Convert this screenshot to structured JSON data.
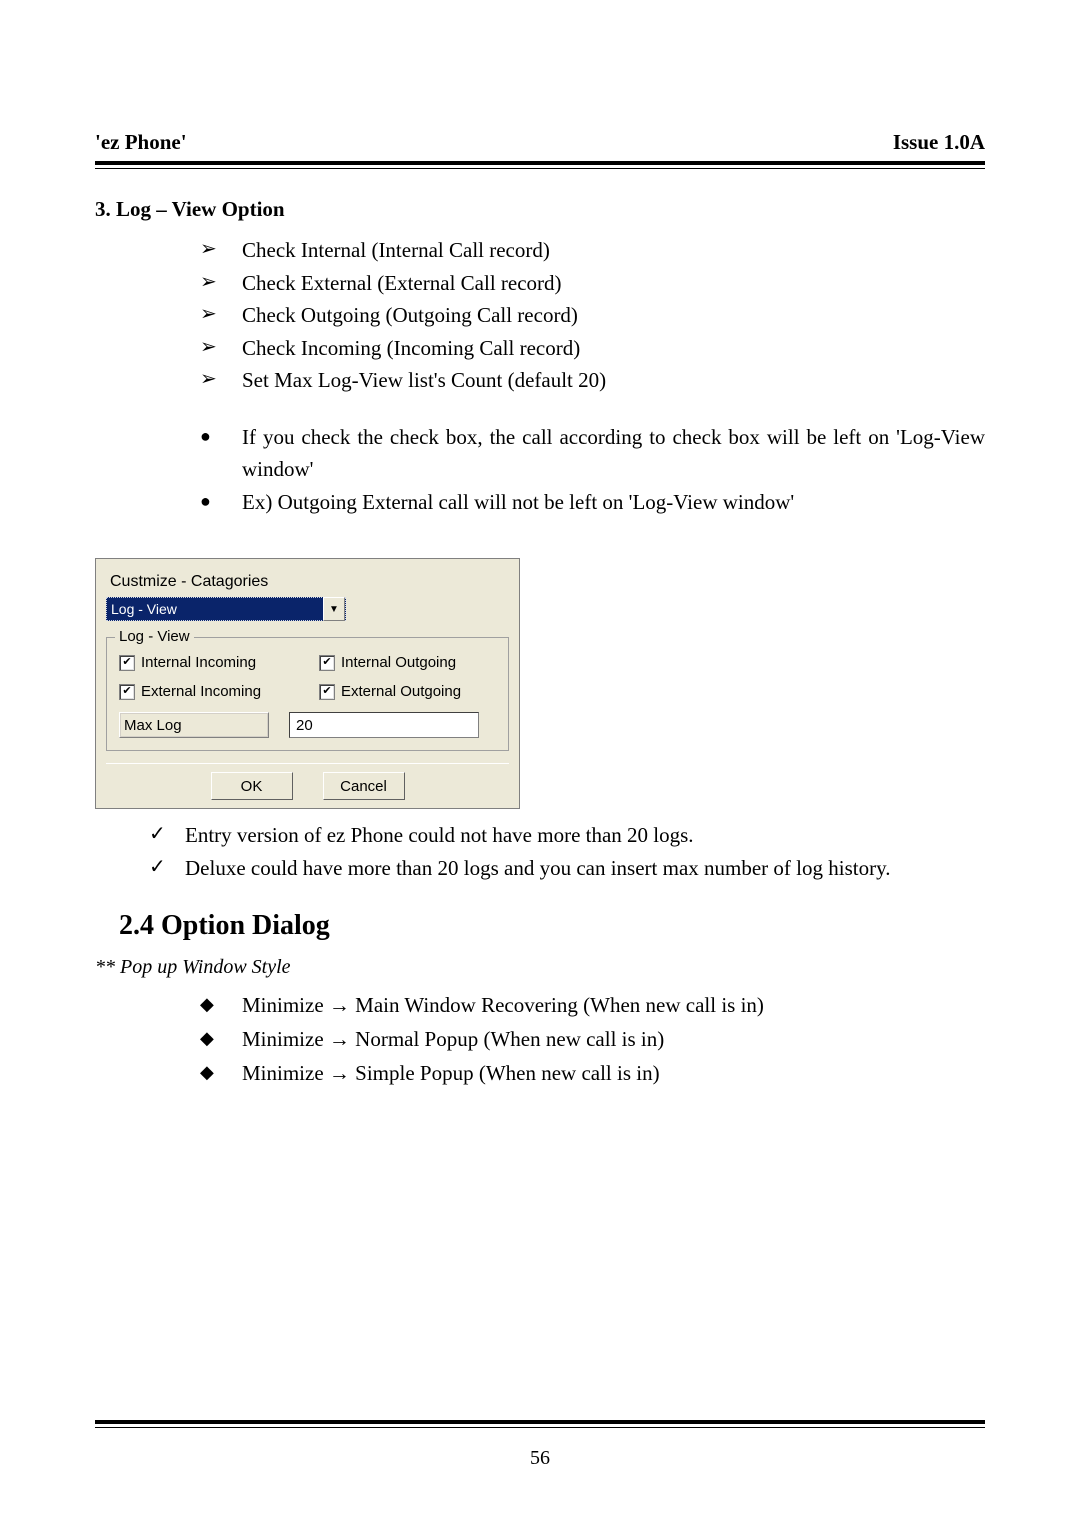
{
  "header": {
    "left": "'ez Phone'",
    "right": "Issue 1.0A"
  },
  "section3": {
    "title": "3. Log – View Option",
    "arrows": [
      "Check Internal   (Internal Call record)",
      "Check External (External Call record)",
      "Check Outgoing (Outgoing Call record)",
      "Check Incoming (Incoming Call record)",
      "Set Max Log-View list's Count (default 20)"
    ],
    "bullets": [
      "If you check the check box, the call according to check box will be left on 'Log-View window'",
      "Ex) Outgoing External call will not be left on 'Log-View window'"
    ]
  },
  "dialog": {
    "title": "Custmize - Catagories",
    "combo_value": "Log - View",
    "group_legend": "Log - View",
    "chk1": "Internal Incoming",
    "chk2": "Internal Outgoing",
    "chk3": "External Incoming",
    "chk4": "External Outgoing",
    "maxlog_label": "Max Log",
    "maxlog_value": "20",
    "ok": "OK",
    "cancel": "Cancel"
  },
  "checks": [
    "Entry version of ez Phone could not have more than 20 logs.",
    "Deluxe could have more than 20 logs and you can insert max number of log history."
  ],
  "h2": "2.4 Option Dialog",
  "subnote": "** Pop up Window Style",
  "diamonds": {
    "d1a": "Minimize ",
    "d1b": " Main Window Recovering (When new call is in)",
    "d2a": "Minimize ",
    "d2b": " Normal Popup (When new call is in)",
    "d3a": "Minimize ",
    "d3b": " Simple Popup   (When new call is in)"
  },
  "arrow": "→",
  "page_number": "56"
}
